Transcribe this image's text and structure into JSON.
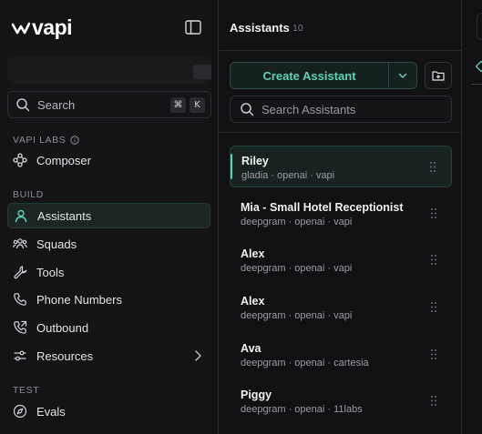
{
  "app": {
    "logo_text": "vapi",
    "accent": "#5dd3b4"
  },
  "sidebar": {
    "search": {
      "label": "Search",
      "shortcut_keys": [
        "⌘",
        "K"
      ]
    },
    "sections": [
      {
        "title": "VAPI LABS",
        "items": [
          {
            "label": "Composer",
            "icon": "composer-icon"
          }
        ]
      },
      {
        "title": "BUILD",
        "items": [
          {
            "label": "Assistants",
            "icon": "user-icon",
            "active": true
          },
          {
            "label": "Squads",
            "icon": "people-icon"
          },
          {
            "label": "Tools",
            "icon": "wrench-icon"
          },
          {
            "label": "Phone Numbers",
            "icon": "phone-icon"
          },
          {
            "label": "Outbound",
            "icon": "phone-outgoing-icon"
          },
          {
            "label": "Resources",
            "icon": "sliders-icon"
          }
        ]
      },
      {
        "title": "TEST",
        "items": [
          {
            "label": "Evals",
            "icon": "compass-icon"
          }
        ]
      }
    ]
  },
  "assistants": {
    "title": "Assistants",
    "count": "10",
    "create_label": "Create Assistant",
    "search_placeholder": "Search Assistants",
    "items": [
      {
        "name": "Riley",
        "meta": "gladia · openai · vapi",
        "selected": true
      },
      {
        "name": "Mia - Small Hotel Receptionist",
        "meta": "deepgram · openai · vapi"
      },
      {
        "name": "Alex",
        "meta": "deepgram · openai · vapi"
      },
      {
        "name": "Alex",
        "meta": "deepgram · openai · vapi"
      },
      {
        "name": "Ava",
        "meta": "deepgram · openai · cartesia"
      },
      {
        "name": "Piggy",
        "meta": "deepgram · openai · 11labs"
      }
    ]
  }
}
